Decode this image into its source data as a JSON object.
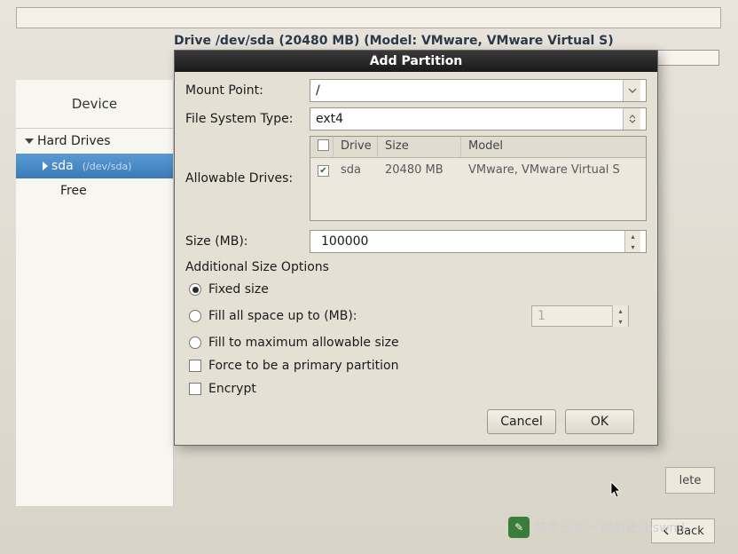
{
  "drive_info": "Drive /dev/sda (20480 MB) (Model: VMware, VMware Virtual S)",
  "sidebar": {
    "header": "Device",
    "hard_drives": "Hard Drives",
    "sda": "sda",
    "sda_path": "(/dev/sda)",
    "free": "Free"
  },
  "dialog": {
    "title": "Add Partition",
    "mount_point_label": "Mount Point:",
    "mount_point_value": "/",
    "fs_type_label": "File System Type:",
    "fs_type_value": "ext4",
    "allowable_label": "Allowable Drives:",
    "drive_table": {
      "headers": {
        "drive": "Drive",
        "size": "Size",
        "model": "Model"
      },
      "row": {
        "checked": true,
        "drive": "sda",
        "size": "20480 MB",
        "model": "VMware, VMware Virtual S"
      }
    },
    "size_label": "Size (MB):",
    "size_value": "100000",
    "additional_title": "Additional Size Options",
    "opt_fixed": "Fixed size",
    "opt_fill_up": "Fill all space up to (MB):",
    "opt_fill_up_value": "1",
    "opt_fill_max": "Fill to maximum allowable size",
    "force_primary": "Force to be a primary partition",
    "encrypt": "Encrypt",
    "cancel": "Cancel",
    "ok": "OK"
  },
  "bg": {
    "delete": "lete",
    "back": "Back"
  },
  "watermark": "技术分享 一起前进shswml"
}
